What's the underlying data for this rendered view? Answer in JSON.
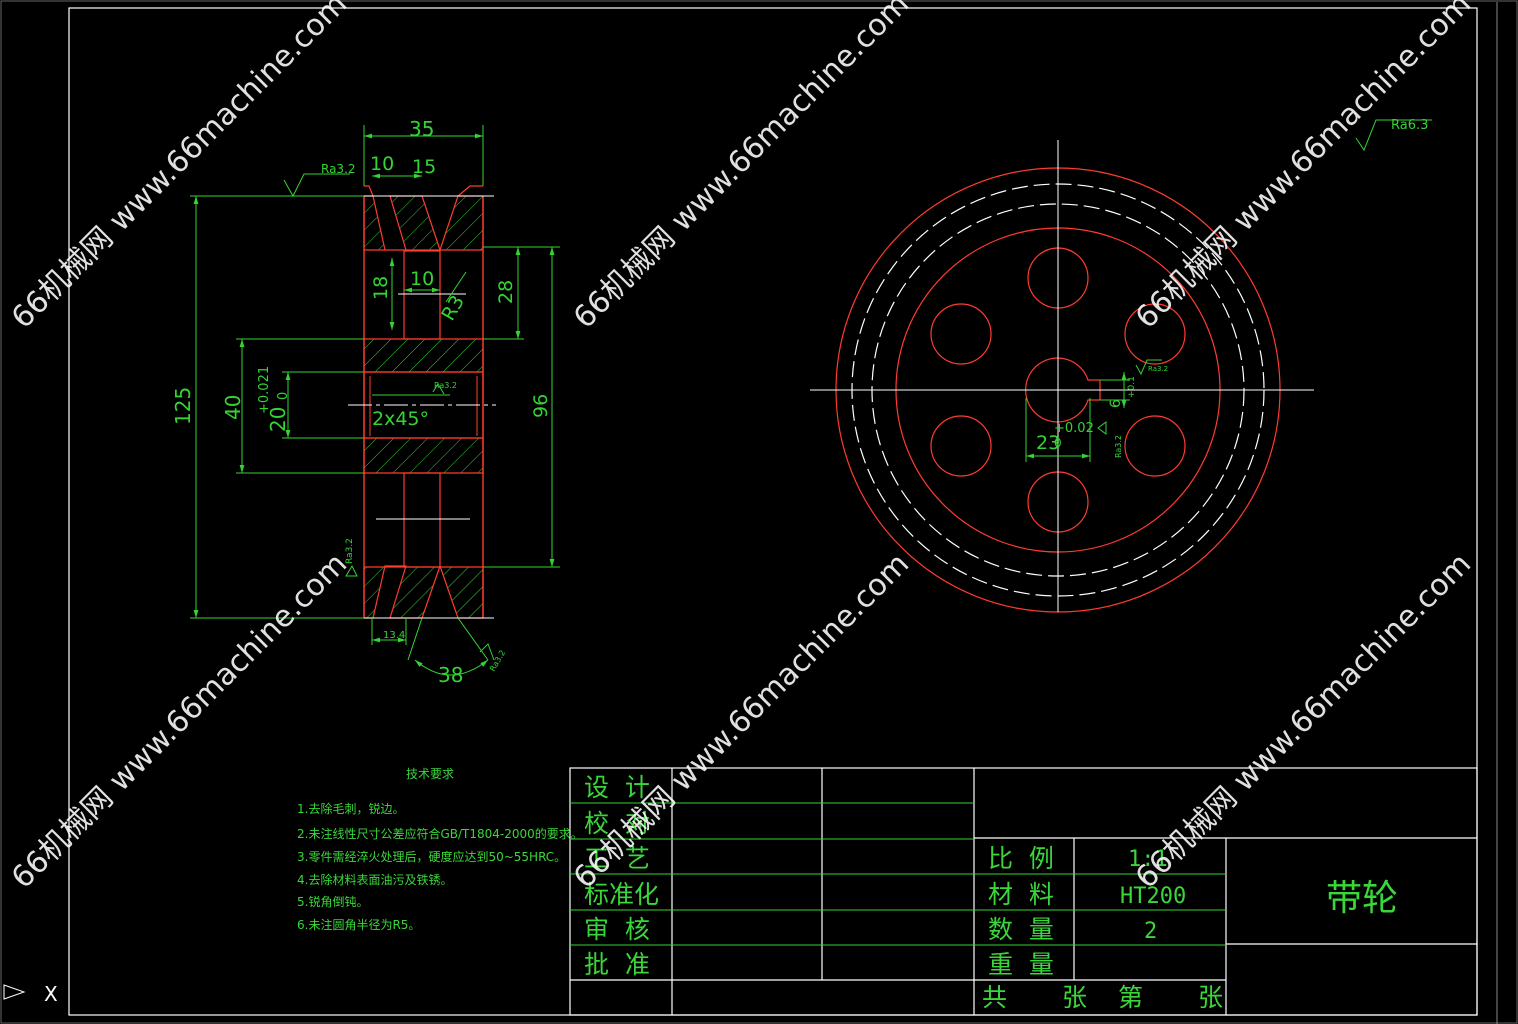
{
  "colors": {
    "background": "#000000",
    "frame": "#ffffff",
    "outline": "#ff3b30",
    "dimension": "#34d434",
    "hatch": "#34d434",
    "centerline": "#ffffff"
  },
  "watermark": "66机械网 www.66machine.com",
  "front_view": {
    "dims": {
      "width_total": "35",
      "groove_offset": "10",
      "groove_pitch": "15",
      "outer_dia": "125",
      "hub_dia": "40",
      "bore_dia": "20",
      "bore_tol": "+0.021",
      "bore_tol_low": "0",
      "web_hole": "18",
      "web_hole_width": "10",
      "fillet": "R3",
      "web_height": "28",
      "rim_inner_dia": "96",
      "chamfer": "2x45°",
      "groove_width": "13.4",
      "groove_angle": "38",
      "rough_top": "Ra3.2",
      "rough_bore": "Ra3.2",
      "rough_side": "Ra3.2",
      "rough_groove": "Ra3.2"
    }
  },
  "side_view": {
    "dims": {
      "keyway_width": "23",
      "keyway_tol": "+0.02",
      "keyway_tol_low": "0",
      "key_depth": "6",
      "key_tol": "+0.1",
      "rough_corner": "Ra6.3",
      "rough_key1": "Ra3.2",
      "rough_key2": "Ra3.2"
    }
  },
  "tech_req": {
    "title": "技术要求",
    "items": [
      "1.去除毛刺，锐边。",
      "2.未注线性尺寸公差应符合GB/T1804-2000的要求。",
      "3.零件需经淬火处理后，硬度应达到50~55HRC。",
      "4.去除材料表面油污及铁锈。",
      "5.锐角倒钝。",
      "6.未注圆角半径为R5。"
    ]
  },
  "title_block": {
    "left_labels": [
      "设  计",
      "校  对",
      "工  艺",
      "标准化",
      "审  核",
      "批  准"
    ],
    "scale_label": "比  例",
    "scale_value": "1:1",
    "material_label": "材  料",
    "material_value": "HT200",
    "quantity_label": "数  量",
    "quantity_value": "2",
    "weight_label": "重  量",
    "weight_value": "",
    "sheets_total": "共",
    "sheets_unit": "张",
    "sheet_no": "第",
    "sheet_unit2": "张",
    "part_name": "带轮"
  },
  "ucs_icon": "UCS icon",
  "ucs_axis": "X"
}
